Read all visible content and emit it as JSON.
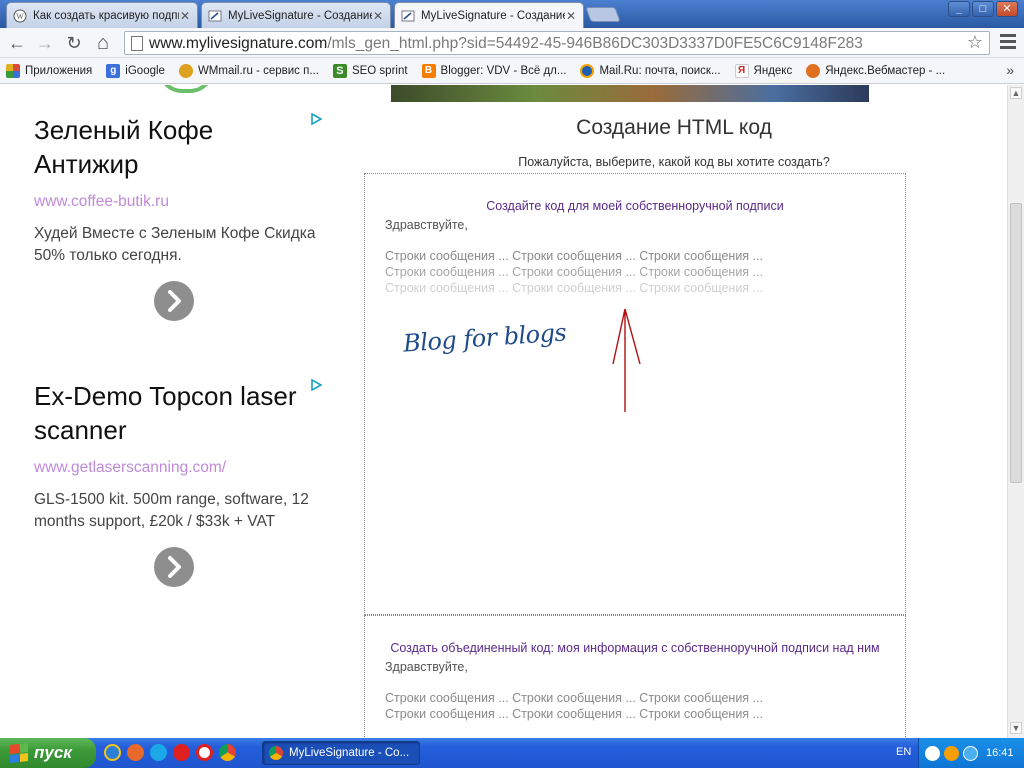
{
  "browser": {
    "tabs": [
      {
        "title": "Как создать красивую подпись",
        "active": false
      },
      {
        "title": "MyLiveSignature - Создание",
        "active": false
      },
      {
        "title": "MyLiveSignature - Создание",
        "active": true
      }
    ],
    "window_controls": {
      "minimize": "_",
      "maximize": "□",
      "close": "✕"
    },
    "url": {
      "host": "www.mylivesignature.com",
      "path": "/mls_gen_html.php?sid=54492-45-946B86DC303D3337D0FE5C6C9148F283"
    },
    "nav": {
      "back": "←",
      "forward": "→",
      "reload": "↻",
      "home": "⌂"
    },
    "bookmarks": [
      {
        "label": "Приложения",
        "icon": "apps-grid-icon",
        "color": "#d94a3b"
      },
      {
        "label": "iGoogle",
        "icon": "google-icon",
        "color": "#3b6fd9"
      },
      {
        "label": "WMmail.ru - сервис п...",
        "icon": "wmmail-icon",
        "color": "#e0a020"
      },
      {
        "label": "SEO sprint",
        "icon": "seosprint-icon",
        "color": "#3a8a2a"
      },
      {
        "label": "Blogger: VDV - Всё дл...",
        "icon": "blogger-icon",
        "color": "#f57d00"
      },
      {
        "label": "Mail.Ru: почта, поиск...",
        "icon": "mailru-icon",
        "color": "#1a5fb4"
      },
      {
        "label": "Яндекс",
        "icon": "yandex-icon",
        "color": "#cc2222"
      },
      {
        "label": "Яндекс.Вебмастер - ...",
        "icon": "yandex-webmaster-icon",
        "color": "#e07020"
      }
    ],
    "bookmarks_more": "»"
  },
  "ads": [
    {
      "title": "Зеленый Кофе Антижир",
      "url": "www.coffee-butik.ru",
      "text": "Худей Вместе с Зеленым Кофе Скидка 50% только сегодня."
    },
    {
      "title": "Ex-Demo Topcon laser scanner",
      "url": "www.getlaserscanning.com/",
      "text": "GLS-1500 kit. 500m range, software, 12 months support, £20k / $33k + VAT"
    }
  ],
  "main": {
    "title": "Создание HTML код",
    "subtitle": "Пожалуйста, выберите, какой код вы хотите создать?",
    "option1": {
      "title": "Создайте код для моей собственноручной подписи",
      "greeting": "Здравствуйте,",
      "lines": [
        "Строки сообщения ... Строки сообщения ... Строки сообщения ...",
        "Строки сообщения ... Строки сообщения ... Строки сообщения ...",
        "Строки сообщения ... Строки сообщения ... Строки сообщения ..."
      ],
      "signature": "Blog for blogs"
    },
    "option2": {
      "title": "Создать объединенный код: моя информация с собственноручной подписи над ним",
      "greeting": "Здравствуйте,",
      "lines": [
        "Строки сообщения ... Строки сообщения ... Строки сообщения ...",
        "Строки сообщения ... Строки сообщения ... Строки сообщения ..."
      ]
    }
  },
  "taskbar": {
    "start_label": "пуск",
    "task_label": "MyLiveSignature - Co...",
    "lang": "EN",
    "clock": "16:41"
  },
  "colors": {
    "accent_purple": "#5a2a8a",
    "ad_url": "#c08ad8",
    "annotation_arrow": "#b01010"
  }
}
